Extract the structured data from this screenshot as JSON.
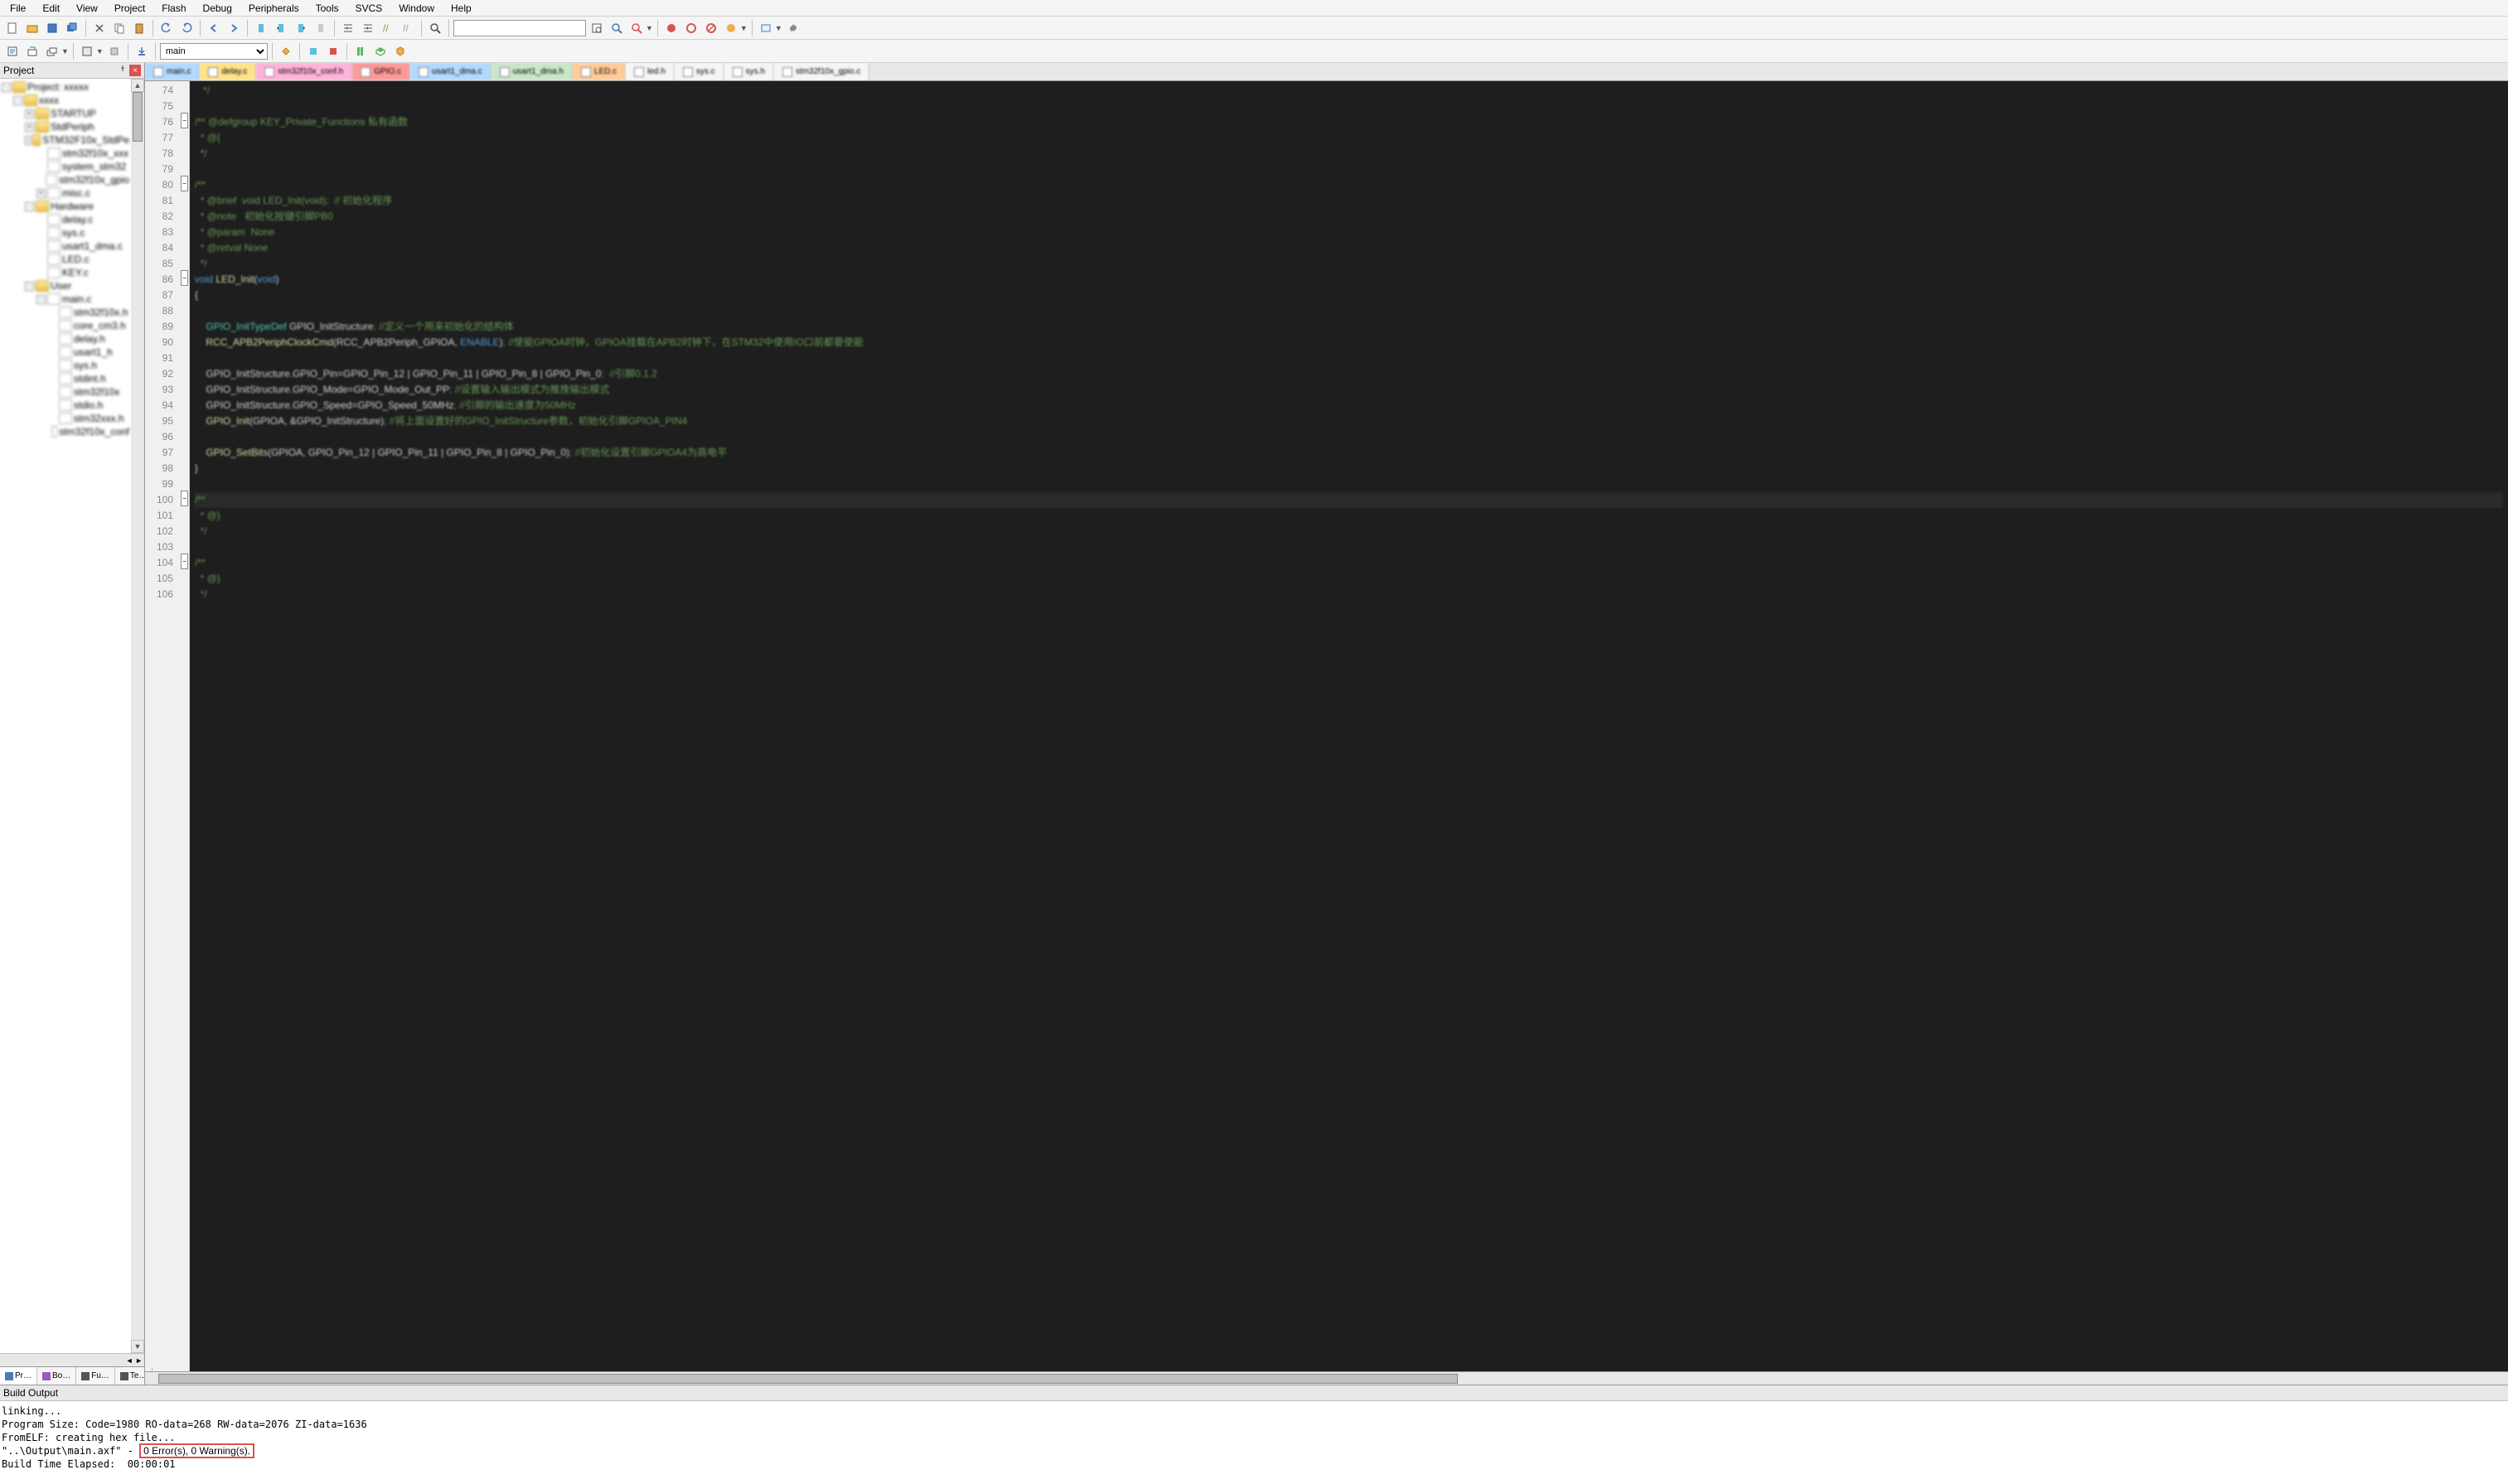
{
  "menu": [
    "File",
    "Edit",
    "View",
    "Project",
    "Flash",
    "Debug",
    "Peripherals",
    "Tools",
    "SVCS",
    "Window",
    "Help"
  ],
  "toolbar2_target": "main",
  "project_pane_title": "Project",
  "tree": [
    {
      "ind": 0,
      "exp": "-",
      "type": "folder",
      "label": "Project: xxxxx"
    },
    {
      "ind": 1,
      "exp": "-",
      "type": "folder",
      "label": "xxxx"
    },
    {
      "ind": 2,
      "exp": "+",
      "type": "folder",
      "label": "STARTUP"
    },
    {
      "ind": 2,
      "exp": "+",
      "type": "folder",
      "label": "StdPeriph"
    },
    {
      "ind": 2,
      "exp": "-",
      "type": "folder",
      "label": "STM32F10x_StdPe"
    },
    {
      "ind": 3,
      "exp": "",
      "type": "file",
      "label": "stm32f10x_xxx"
    },
    {
      "ind": 3,
      "exp": "",
      "type": "file",
      "label": "system_stm32"
    },
    {
      "ind": 3,
      "exp": "",
      "type": "file",
      "label": "stm32f10x_gpio"
    },
    {
      "ind": 3,
      "exp": "+",
      "type": "file",
      "label": "misc.c"
    },
    {
      "ind": 2,
      "exp": "-",
      "type": "folder",
      "label": "Hardware"
    },
    {
      "ind": 3,
      "exp": "",
      "type": "file",
      "label": "delay.c"
    },
    {
      "ind": 3,
      "exp": "",
      "type": "file",
      "label": "sys.c"
    },
    {
      "ind": 3,
      "exp": "",
      "type": "file",
      "label": "usart1_dma.c"
    },
    {
      "ind": 3,
      "exp": "",
      "type": "file",
      "label": "LED.c"
    },
    {
      "ind": 3,
      "exp": "",
      "type": "file",
      "label": "KEY.c"
    },
    {
      "ind": 2,
      "exp": "-",
      "type": "folder",
      "label": "User"
    },
    {
      "ind": 3,
      "exp": "-",
      "type": "file",
      "label": "main.c"
    },
    {
      "ind": 4,
      "exp": "",
      "type": "file",
      "label": "stm32f10x.h"
    },
    {
      "ind": 4,
      "exp": "",
      "type": "file",
      "label": "core_cm3.h"
    },
    {
      "ind": 4,
      "exp": "",
      "type": "file",
      "label": "delay.h"
    },
    {
      "ind": 4,
      "exp": "",
      "type": "file",
      "label": "usart1_h"
    },
    {
      "ind": 4,
      "exp": "",
      "type": "file",
      "label": "sys.h"
    },
    {
      "ind": 4,
      "exp": "",
      "type": "file",
      "label": "stdint.h"
    },
    {
      "ind": 4,
      "exp": "",
      "type": "file",
      "label": "stm32f10x"
    },
    {
      "ind": 4,
      "exp": "",
      "type": "file",
      "label": "stdio.h"
    },
    {
      "ind": 4,
      "exp": "",
      "type": "file",
      "label": "stm32xxx.h"
    },
    {
      "ind": 4,
      "exp": "",
      "type": "file",
      "label": "stm32f10x_conf"
    }
  ],
  "bottom_tabs": [
    "Pr…",
    "Bo…",
    "Fu…",
    "Te…"
  ],
  "file_tabs": [
    {
      "label": "main.c",
      "cls": "ft-blue"
    },
    {
      "label": "delay.c",
      "cls": "ft-yellow"
    },
    {
      "label": "stm32f10x_conf.h",
      "cls": "ft-pink"
    },
    {
      "label": "GPIO.c",
      "cls": "ft-red"
    },
    {
      "label": "usart1_dma.c",
      "cls": "ft-blue"
    },
    {
      "label": "usart1_dma.h",
      "cls": "ft-green"
    },
    {
      "label": "LED.c",
      "cls": "ft-orange"
    },
    {
      "label": "led.h",
      "cls": "ft-default"
    },
    {
      "label": "sys.c",
      "cls": "ft-default"
    },
    {
      "label": "sys.h",
      "cls": "ft-default"
    },
    {
      "label": "stm32f10x_gpio.c",
      "cls": "ft-default"
    }
  ],
  "first_line_no": 74,
  "code_lines": [
    {
      "cls": "c-comment",
      "text": "   */"
    },
    {
      "cls": "",
      "text": ""
    },
    {
      "cls": "c-comment",
      "text": "/** @defgroup KEY_Private_Functions 私有函数"
    },
    {
      "cls": "c-comment",
      "text": "  * @{"
    },
    {
      "cls": "c-comment",
      "text": "  */"
    },
    {
      "cls": "",
      "text": ""
    },
    {
      "cls": "c-comment",
      "text": "/**"
    },
    {
      "cls": "c-comment",
      "text": "  * @brief  void LED_Init(void);  // 初始化程序"
    },
    {
      "cls": "c-comment",
      "text": "  * @note   初始化按键引脚PB0"
    },
    {
      "cls": "c-comment",
      "text": "  * @param  None"
    },
    {
      "cls": "c-comment",
      "text": "  * @retval None"
    },
    {
      "cls": "c-comment",
      "text": "  */"
    },
    {
      "cls": "",
      "text": "<span class='c-keyword'>void</span> <span class='c-func'>LED_Init</span>(<span class='c-keyword'>void</span>)"
    },
    {
      "cls": "",
      "text": "{"
    },
    {
      "cls": "",
      "text": ""
    },
    {
      "cls": "",
      "text": "    <span class='c-type'>GPIO_InitTypeDef</span> GPIO_InitStructure<span class='c-comment'>; //定义一个用来初始化的结构体</span>"
    },
    {
      "cls": "",
      "text": "    <span class='c-func'>RCC_APB2PeriphClockCmd</span>(RCC_APB2Periph_GPIOA, <span class='c-keyword'>ENABLE</span>)<span class='c-comment'>; //使能GPIOA时钟，GPIOA挂载在APB2时钟下，在STM32中使用IO口前都要使能</span>"
    },
    {
      "cls": "",
      "text": ""
    },
    {
      "cls": "",
      "text": "    GPIO_InitStructure.GPIO_Pin=GPIO_Pin_12 | GPIO_Pin_11 | GPIO_Pin_8 | GPIO_Pin_0<span class='c-comment'>;  //引脚0.1.2</span>"
    },
    {
      "cls": "",
      "text": "    GPIO_InitStructure.GPIO_Mode=GPIO_Mode_Out_PP<span class='c-comment'>; //设置输入输出模式为推挽输出模式</span>"
    },
    {
      "cls": "",
      "text": "    GPIO_InitStructure.GPIO_Speed=GPIO_Speed_50MHz<span class='c-comment'>; //引脚的输出速度为50MHz</span>"
    },
    {
      "cls": "",
      "text": "    <span class='c-func'>GPIO_Init</span>(GPIOA, &GPIO_InitStructure)<span class='c-comment'>; //将上面设置好的GPIO_InitStructure参数，初始化引脚GPIOA_PIN4</span>"
    },
    {
      "cls": "",
      "text": ""
    },
    {
      "cls": "",
      "text": "    <span class='c-func'>GPIO_SetBits</span>(GPIOA, GPIO_Pin_12 | GPIO_Pin_11 | GPIO_Pin_8 | GPIO_Pin_0)<span class='c-comment'>; //初始化设置引脚GPIOA4为高电平</span>"
    },
    {
      "cls": "",
      "text": "}"
    },
    {
      "cls": "",
      "text": ""
    },
    {
      "cls": "c-comment current-line",
      "text": "/**"
    },
    {
      "cls": "c-comment",
      "text": "  * @}"
    },
    {
      "cls": "c-comment",
      "text": "  */"
    },
    {
      "cls": "",
      "text": ""
    },
    {
      "cls": "c-comment",
      "text": "/**"
    },
    {
      "cls": "c-comment",
      "text": "  * @}"
    },
    {
      "cls": "c-comment",
      "text": "  */"
    }
  ],
  "build_pane_title": "Build Output",
  "build_lines": [
    "linking...",
    "Program Size: Code=1980 RO-data=268 RW-data=2076 ZI-data=1636",
    "FromELF: creating hex file...",
    "\"..\\Output\\main.axf\" - ",
    "Build Time Elapsed:  00:00:01"
  ],
  "build_result": "0 Error(s), 0 Warning(s)."
}
